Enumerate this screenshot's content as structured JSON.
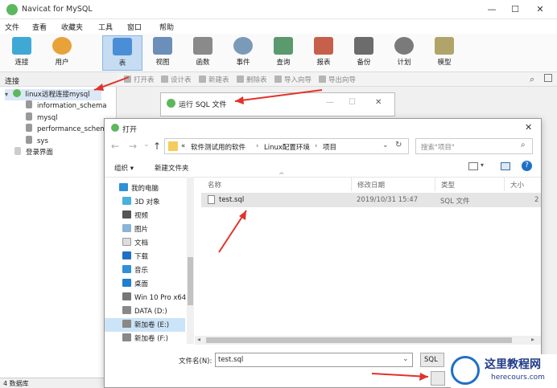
{
  "window": {
    "title": "Navicat for MySQL",
    "min": "—",
    "max": "☐",
    "close": "✕"
  },
  "menu": [
    "文件",
    "查看",
    "收藏夹",
    "工具",
    "窗口",
    "帮助"
  ],
  "toolbar": [
    {
      "label": "连接",
      "icon": "connect-icon",
      "color": "#3fa9d6"
    },
    {
      "label": "用户",
      "icon": "user-icon",
      "color": "#e8a23a"
    },
    {
      "label": "表",
      "icon": "table-icon",
      "color": "#4a8fd6"
    },
    {
      "label": "视图",
      "icon": "view-icon",
      "color": "#6b8fb8"
    },
    {
      "label": "函数",
      "icon": "function-icon",
      "color": "#8a8a8a"
    },
    {
      "label": "事件",
      "icon": "event-icon",
      "color": "#7a9ab8"
    },
    {
      "label": "查询",
      "icon": "query-icon",
      "color": "#5a9a6e"
    },
    {
      "label": "报表",
      "icon": "report-icon",
      "color": "#c7604a"
    },
    {
      "label": "备份",
      "icon": "backup-icon",
      "color": "#6c6c6c"
    },
    {
      "label": "计划",
      "icon": "schedule-icon",
      "color": "#7a7a7a"
    },
    {
      "label": "模型",
      "icon": "model-icon",
      "color": "#b0a46a"
    }
  ],
  "left": {
    "header": "连接",
    "connection": "linux远程连接mysql",
    "databases": [
      "information_schema",
      "mysql",
      "performance_schem",
      "sys"
    ],
    "other": "登录界面"
  },
  "objbar": [
    "打开表",
    "设计表",
    "新建表",
    "删除表",
    "导入向导",
    "导出向导"
  ],
  "status": "4 数据库",
  "rundialog": {
    "title": "运行 SQL 文件",
    "min": "—",
    "max": "☐",
    "close": "✕"
  },
  "opendialog": {
    "title": "打开",
    "close": "✕",
    "path": [
      "软件测试用的软件",
      "Linux配置环境",
      "项目"
    ],
    "path_prefix": "«",
    "search_placeholder": "搜索\"项目\"",
    "organize": "组织 ▾",
    "newfolder": "新建文件夹",
    "nav": [
      "我的电脑",
      "3D 对象",
      "视频",
      "图片",
      "文档",
      "下载",
      "音乐",
      "桌面",
      "Win 10 Pro x64",
      "DATA (D:)",
      "新加卷 (E:)",
      "新加卷 (F:)"
    ],
    "columns": [
      "名称",
      "修改日期",
      "类型",
      "大小"
    ],
    "file": {
      "name": "test.sql",
      "date": "2019/10/31 15:47",
      "type": "SQL 文件",
      "size": "2"
    },
    "filename_label": "文件名(N):",
    "filename_value": "test.sql",
    "filetype_btn": "SQL"
  },
  "watermark": {
    "title": "这里教程网",
    "url": "herecours.com"
  }
}
